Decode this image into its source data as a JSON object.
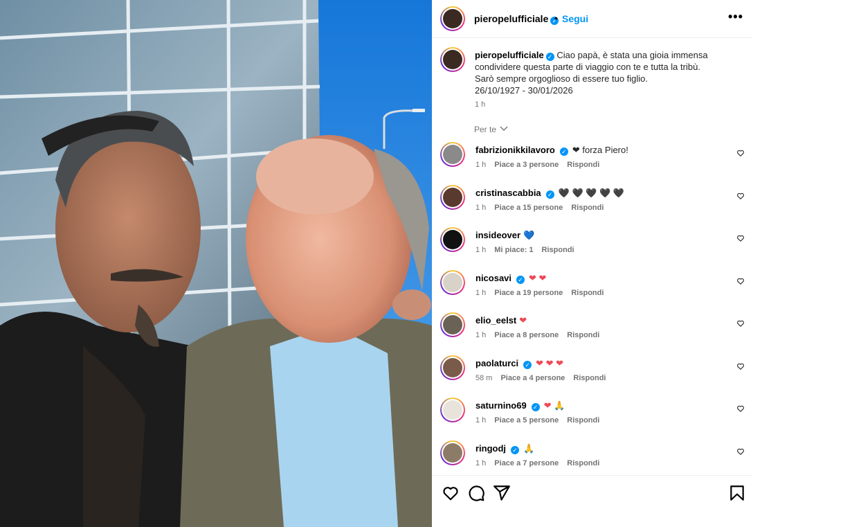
{
  "post": {
    "username": "pieropelufficiale",
    "verified": true,
    "separator": "•",
    "follow_label": "Segui",
    "more_label": "•••",
    "caption_lines": [
      "Ciao papà, è stata una gioia immensa",
      "condividere questa parte di viaggio con te e tutta la tribù.",
      "Sarò sempre orgoglioso di essere tuo figlio.",
      "26/10/1927 - 30/01/2026"
    ],
    "time": "1 h"
  },
  "sort_label": "Per te",
  "comments": [
    {
      "username": "fabrizionikkilavoro",
      "verified": true,
      "text": "❤ forza Piero!",
      "time": "1 h",
      "likes": "Piace a 3 persone",
      "reply": "Rispondi",
      "avatar_color": "#8a8a8a"
    },
    {
      "username": "cristinascabbia",
      "verified": true,
      "text": "🖤 🖤 🖤 🖤 🖤",
      "time": "1 h",
      "likes": "Piace a 15 persone",
      "reply": "Rispondi",
      "avatar_color": "#5a3a2e"
    },
    {
      "username": "insideover",
      "verified": false,
      "text": "💙",
      "time": "1 h",
      "likes": "Mi piace: 1",
      "reply": "Rispondi",
      "avatar_color": "#111111"
    },
    {
      "username": "nicosavi",
      "verified": true,
      "text": "❤ ❤",
      "time": "1 h",
      "likes": "Piace a 19 persone",
      "reply": "Rispondi",
      "avatar_color": "#d9d2c8"
    },
    {
      "username": "elio_eelst",
      "verified": false,
      "text": "❤",
      "time": "1 h",
      "likes": "Piace a 8 persone",
      "reply": "Rispondi",
      "avatar_color": "#6b6256"
    },
    {
      "username": "paolaturci",
      "verified": true,
      "text": "❤ ❤ ❤",
      "time": "58 m",
      "likes": "Piace a 4 persone",
      "reply": "Rispondi",
      "avatar_color": "#7a5a48"
    },
    {
      "username": "saturnino69",
      "verified": true,
      "text": "❤ 🙏",
      "time": "1 h",
      "likes": "Piace a 5 persone",
      "reply": "Rispondi",
      "avatar_color": "#e8e4dc"
    },
    {
      "username": "ringodj",
      "verified": true,
      "text": "🙏",
      "time": "1 h",
      "likes": "Piace a 7 persone",
      "reply": "Rispondi",
      "avatar_color": "#8c7b66"
    }
  ],
  "actions": {
    "like_icon": "heart-icon",
    "comment_icon": "comment-icon",
    "share_icon": "share-icon",
    "save_icon": "bookmark-icon"
  },
  "colors": {
    "accent": "#0095f6",
    "secondary_text": "#737373",
    "heart": "#ed4956"
  }
}
